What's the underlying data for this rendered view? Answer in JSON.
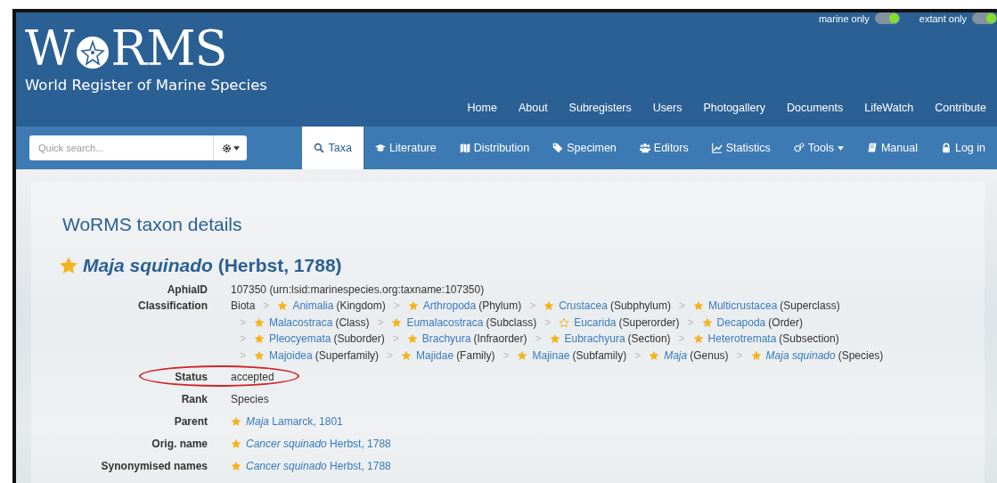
{
  "logo": {
    "before": "W",
    "after": "RMS",
    "subtitle": "World Register of Marine Species"
  },
  "toggles": [
    {
      "label": "marine only",
      "on": true
    },
    {
      "label": "extant only",
      "on": true
    }
  ],
  "top_nav": [
    "Home",
    "About",
    "Subregisters",
    "Users",
    "Photogallery",
    "Documents",
    "LifeWatch",
    "Contribute"
  ],
  "search": {
    "placeholder": "Quick search..."
  },
  "tabs": [
    {
      "label": "Taxa",
      "selected": true,
      "dropdown": false
    },
    {
      "label": "Literature",
      "selected": false,
      "dropdown": false
    },
    {
      "label": "Distribution",
      "selected": false,
      "dropdown": false
    },
    {
      "label": "Specimen",
      "selected": false,
      "dropdown": false
    },
    {
      "label": "Editors",
      "selected": false,
      "dropdown": false
    },
    {
      "label": "Statistics",
      "selected": false,
      "dropdown": false
    },
    {
      "label": "Tools",
      "selected": false,
      "dropdown": true
    },
    {
      "label": "Manual",
      "selected": false,
      "dropdown": false
    },
    {
      "label": "Log in",
      "selected": false,
      "dropdown": false
    }
  ],
  "heading": "WoRMS taxon details",
  "taxon_title": "*Maja squinado* (Herbst, 1788)",
  "aphia_id": {
    "label": "AphiaID",
    "value": "107350  (urn:lsid:marinespecies.org:taxname:107350)"
  },
  "classification": {
    "label": "Classification",
    "separator": ">",
    "lines": [
      [
        {
          "name": "Biota",
          "kind": "root",
          "italic": false
        },
        {
          "name": "Animalia",
          "rank": "(Kingdom)",
          "kind": "accepted",
          "italic": false
        },
        {
          "name": "Arthropoda",
          "rank": "(Phylum)",
          "kind": "accepted",
          "italic": false
        },
        {
          "name": "Crustacea",
          "rank": "(Subphylum)",
          "kind": "accepted",
          "italic": false
        },
        {
          "name": "Multicrustacea",
          "rank": "(Superclass)",
          "kind": "accepted",
          "italic": false
        }
      ],
      [
        {
          "name": "Malacostraca",
          "rank": "(Class)",
          "kind": "accepted",
          "italic": false
        },
        {
          "name": "Eumalacostraca",
          "rank": "(Subclass)",
          "kind": "accepted",
          "italic": false
        },
        {
          "name": "Eucarida",
          "rank": "(Superorder)",
          "kind": "unaccepted",
          "italic": false
        },
        {
          "name": "Decapoda",
          "rank": "(Order)",
          "kind": "accepted",
          "italic": false
        }
      ],
      [
        {
          "name": "Pleocyemata",
          "rank": "(Suborder)",
          "kind": "accepted",
          "italic": false
        },
        {
          "name": "Brachyura",
          "rank": "(Infraorder)",
          "kind": "accepted",
          "italic": false
        },
        {
          "name": "Eubrachyura",
          "rank": "(Section)",
          "kind": "accepted",
          "italic": false
        },
        {
          "name": "Heterotremata",
          "rank": "(Subsection)",
          "kind": "accepted",
          "italic": false
        }
      ],
      [
        {
          "name": "Majoidea",
          "rank": "(Superfamily)",
          "kind": "accepted",
          "italic": false
        },
        {
          "name": "Majidae",
          "rank": "(Family)",
          "kind": "accepted",
          "italic": false
        },
        {
          "name": "Majinae",
          "rank": "(Subfamily)",
          "kind": "accepted",
          "italic": false
        },
        {
          "name": "Maja",
          "rank": "(Genus)",
          "kind": "accepted",
          "italic": true
        },
        {
          "name": "Maja squinado",
          "rank": "(Species)",
          "kind": "accepted",
          "italic": true
        }
      ]
    ]
  },
  "fields": [
    {
      "label": "Status",
      "value": "accepted",
      "kind": "text",
      "circled": true
    },
    {
      "label": "Rank",
      "value": "Species",
      "kind": "text",
      "circled": false
    },
    {
      "label": "Parent",
      "value": "*Maja* Lamarck, 1801",
      "kind": "link",
      "circled": false
    },
    {
      "label": "Orig. name",
      "value": "*Cancer squinado* Herbst, 1788",
      "kind": "link",
      "circled": false
    },
    {
      "label": "Synonymised names",
      "value": "*Cancer squinado* Herbst, 1788",
      "kind": "link",
      "circled": false
    }
  ]
}
